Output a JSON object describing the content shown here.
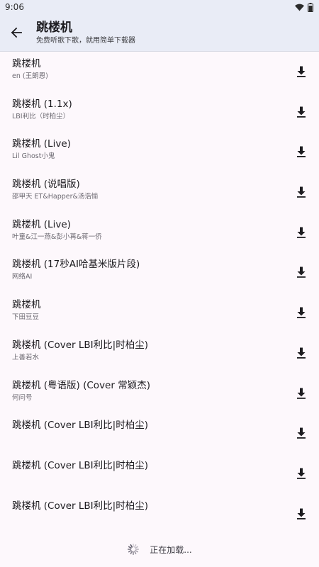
{
  "status": {
    "time": "9:06"
  },
  "header": {
    "title": "跳楼机",
    "subtitle": "免费听歌下歌，就用简单下载器"
  },
  "songs": [
    {
      "title": "跳楼机",
      "artist": "en (王朗恩)"
    },
    {
      "title": "跳楼机 (1.1x)",
      "artist": "LBI利比（时柏尘）"
    },
    {
      "title": "跳楼机 (Live)",
      "artist": "Lil Ghost小鬼"
    },
    {
      "title": "跳楼机 (说唱版)",
      "artist": "邵甲天 ET&Happer&汤浩愉"
    },
    {
      "title": "跳楼机 (Live)",
      "artist": "叶童&江一燕&彭小苒&蒋一侨"
    },
    {
      "title": "跳楼机 (17秒AI哈基米版片段)",
      "artist": "网络AI"
    },
    {
      "title": "跳楼机",
      "artist": "下田豆豆"
    },
    {
      "title": "跳楼机 (Cover LBI利比|时柏尘)",
      "artist": "上善若水"
    },
    {
      "title": "跳楼机 (粤语版) (Cover 常颖杰)",
      "artist": "何问号"
    },
    {
      "title": "跳楼机 (Cover LBI利比|时柏尘)",
      "artist": ""
    },
    {
      "title": "跳楼机 (Cover LBI利比|时柏尘)",
      "artist": ""
    },
    {
      "title": "跳楼机 (Cover LBI利比|时柏尘)",
      "artist": ""
    }
  ],
  "loading_text": "正在加载..."
}
